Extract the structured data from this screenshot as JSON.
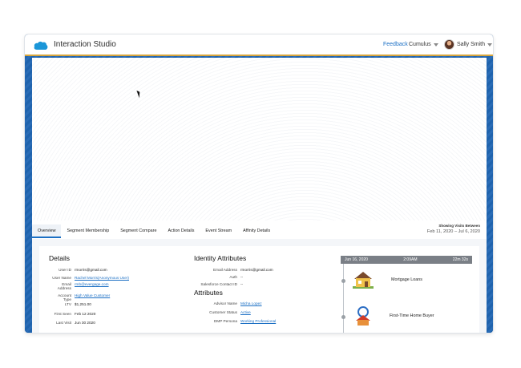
{
  "header": {
    "app_name": "Interaction Studio",
    "feedback": "Feedback",
    "dataset": "Cumulus",
    "user": "Sally Smith"
  },
  "tabs": [
    {
      "label": "Overview",
      "active": true
    },
    {
      "label": "Segment Membership"
    },
    {
      "label": "Segment Compare"
    },
    {
      "label": "Action Details"
    },
    {
      "label": "Event Stream"
    },
    {
      "label": "Affinity Details"
    }
  ],
  "range": {
    "label": "Showing Visits Between",
    "value": "Feb 11, 2020  –  Jul 6, 2020"
  },
  "details": {
    "title": "Details",
    "rows": [
      {
        "key": "User ID",
        "value": "rmorris@gmail.com",
        "link": false
      },
      {
        "key": "User Name",
        "value": "Rachel Morris(Anonymous User)",
        "link": true
      },
      {
        "key": "Email Address",
        "value": "rmb@evergage.com",
        "link": true
      },
      {
        "key": "Account Type",
        "value": "High Value Customer",
        "link": true
      },
      {
        "key": "LTV",
        "value": "$1,251.00",
        "link": false
      },
      {
        "key": "First Seen",
        "value": "Feb 12 2020",
        "link": false
      },
      {
        "key": "Last Visit",
        "value": "Jun 30 2020",
        "link": false
      }
    ]
  },
  "identity": {
    "title": "Identity Attributes",
    "rows": [
      {
        "key": "Email Address",
        "value": "rmorris@gmail.com",
        "link": false
      },
      {
        "key": "Auth",
        "value": "--",
        "link": false
      },
      {
        "key": "Salesforce Contact ID",
        "value": "--",
        "link": false
      }
    ]
  },
  "attributes": {
    "title": "Attributes",
    "rows": [
      {
        "key": "Advisor Name",
        "value": "Micha Lopez",
        "link": true
      },
      {
        "key": "Customer Status",
        "value": "Active",
        "link": true
      },
      {
        "key": "DMP Persona",
        "value": "Working Professional",
        "link": true
      }
    ]
  },
  "timeline": {
    "date": "Jun 16, 2020",
    "time": "2:09AM",
    "duration": "22m 32s",
    "items": [
      {
        "label": "Mortgage Loans",
        "icon": "house-icon"
      },
      {
        "label": "First-Time Home Buyer",
        "icon": "house-key-icon"
      }
    ]
  },
  "colors": {
    "brand_blue": "#1b6fc4",
    "side_blue": "#1f63ad",
    "accent_gold": "#d8a53c"
  }
}
